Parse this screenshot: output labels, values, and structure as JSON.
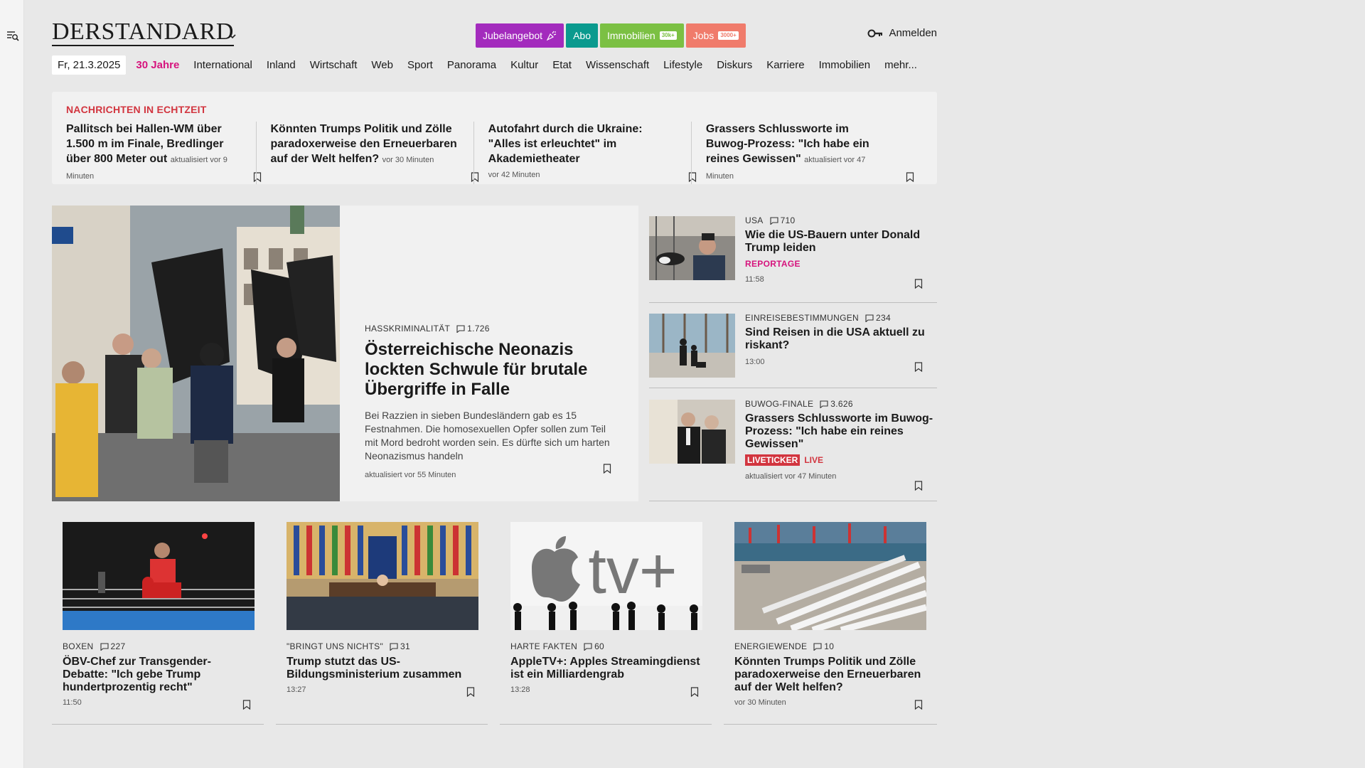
{
  "header": {
    "logo": "DERSTANDARD",
    "login": "Anmelden",
    "promos": [
      {
        "label": "Jubelangebot",
        "color": "#a32bbd",
        "badge": ""
      },
      {
        "label": "Abo",
        "color": "#0a9a8e",
        "badge": ""
      },
      {
        "label": "Immobilien",
        "color": "#7bc043",
        "badge": "30k+"
      },
      {
        "label": "Jobs",
        "color": "#f07b6b",
        "badge": "3000+"
      }
    ]
  },
  "nav": {
    "date": "Fr, 21.3.2025",
    "items": [
      "30 Jahre",
      "International",
      "Inland",
      "Wirtschaft",
      "Web",
      "Sport",
      "Panorama",
      "Kultur",
      "Etat",
      "Wissenschaft",
      "Lifestyle",
      "Diskurs",
      "Karriere",
      "Immobilien",
      "mehr..."
    ]
  },
  "ticker": {
    "heading": "NACHRICHTEN IN ECHTZEIT",
    "items": [
      {
        "title": "Pallitsch bei Hallen-WM über 1.500 m im Finale, Bredlinger über 800 Meter out",
        "meta": "aktualisiert vor 9 Minuten"
      },
      {
        "title": "Könnten Trumps Politik und Zölle paradoxerweise den Erneuerbaren auf der Welt helfen?",
        "meta": "vor 30 Minuten"
      },
      {
        "title": "Autofahrt durch die Ukraine: \"Alles ist erleuchtet\" im Akademietheater",
        "meta": "vor 42 Minuten"
      },
      {
        "title": "Grassers Schlussworte im Buwog-Prozess: \"Ich habe ein reines Gewissen\"",
        "meta": "aktualisiert vor 47 Minuten"
      }
    ]
  },
  "lead": {
    "kicker": "HASSKRIMINALITÄT",
    "comments": "1.726",
    "title": "Österreichische Neonazis lockten Schwule für brutale Übergriffe in Falle",
    "teaser": "Bei Razzien in sieben Bundesländern gab es 15 Festnahmen. Die homosexuellen Opfer sollen zum Teil mit Mord bedroht worden sein. Es dürfte sich um harten Neonazismus handeln",
    "time": "aktualisiert vor 55 Minuten"
  },
  "side": [
    {
      "kicker": "USA",
      "comments": "710",
      "title": "Wie die US-Bauern unter Donald Trump leiden",
      "tag": "REPORTAGE",
      "time": "11:58"
    },
    {
      "kicker": "EINREISEBESTIMMUNGEN",
      "comments": "234",
      "title": "Sind Reisen in die USA aktuell zu riskant?",
      "tag": "",
      "time": "13:00"
    },
    {
      "kicker": "BUWOG-FINALE",
      "comments": "3.626",
      "title": "Grassers Schlussworte im Buwog-Prozess: \"Ich habe ein reines Gewissen\"",
      "live_label": "LIVETICKER",
      "live": "LIVE",
      "time": "aktualisiert vor 47 Minuten"
    }
  ],
  "cards": [
    {
      "kicker": "BOXEN",
      "comments": "227",
      "title": "ÖBV-Chef zur Transgender-Debatte: \"Ich gebe Trump hundertprozentig recht\"",
      "time": "11:50"
    },
    {
      "kicker": "\"BRINGT UNS NICHTS\"",
      "comments": "31",
      "title": "Trump stutzt das US-Bildungsministerium zusammen",
      "time": "13:27"
    },
    {
      "kicker": "HARTE FAKTEN",
      "comments": "60",
      "title": "AppleTV+: Apples Streamingdienst ist ein Milliardengrab",
      "time": "13:28",
      "image_text": "tv+"
    },
    {
      "kicker": "ENERGIEWENDE",
      "comments": "10",
      "title": "Könnten Trumps Politik und Zölle paradoxerweise den Erneuerbaren auf der Welt helfen?",
      "time": "vor 30 Minuten"
    }
  ],
  "icons": {
    "menu": "menu-search-icon",
    "chevron": "chevron-down-icon",
    "key": "key-icon",
    "comment": "comment-icon",
    "bookmark": "bookmark-icon",
    "sparkle": "party-popper-icon"
  },
  "colors": {
    "accent_pink": "#d6137d",
    "accent_red": "#d2353f"
  }
}
